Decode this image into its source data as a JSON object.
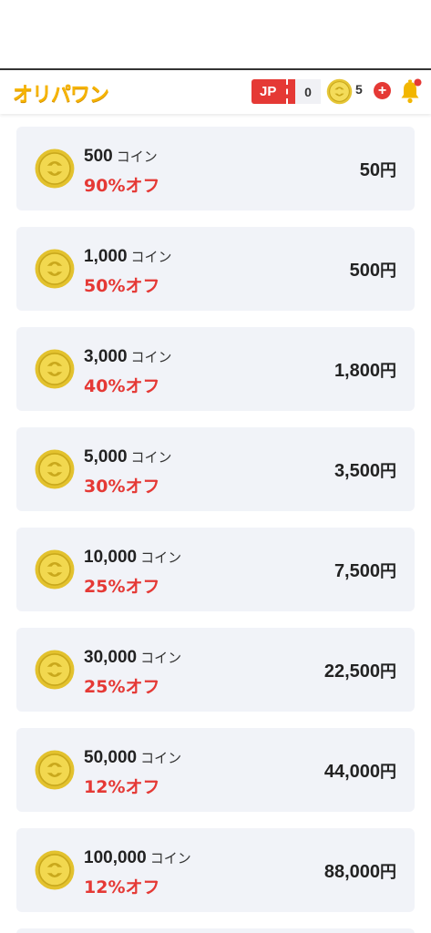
{
  "header": {
    "logo": "オリパワン",
    "jp_label": "JP",
    "jp_count": "0",
    "coin_count": "5",
    "icons": [
      "coin-icon",
      "plus-icon",
      "bell-icon"
    ],
    "accent": "#e53935",
    "brand": "#f6b400"
  },
  "packages": [
    {
      "coins": "500",
      "unit": "コイン",
      "discount": "90%オフ",
      "price": "50",
      "yen": "円"
    },
    {
      "coins": "1,000",
      "unit": "コイン",
      "discount": "50%オフ",
      "price": "500",
      "yen": "円"
    },
    {
      "coins": "3,000",
      "unit": "コイン",
      "discount": "40%オフ",
      "price": "1,800",
      "yen": "円"
    },
    {
      "coins": "5,000",
      "unit": "コイン",
      "discount": "30%オフ",
      "price": "3,500",
      "yen": "円"
    },
    {
      "coins": "10,000",
      "unit": "コイン",
      "discount": "25%オフ",
      "price": "7,500",
      "yen": "円"
    },
    {
      "coins": "30,000",
      "unit": "コイン",
      "discount": "25%オフ",
      "price": "22,500",
      "yen": "円"
    },
    {
      "coins": "50,000",
      "unit": "コイン",
      "discount": "12%オフ",
      "price": "44,000",
      "yen": "円"
    },
    {
      "coins": "100,000",
      "unit": "コイン",
      "discount": "12%オフ",
      "price": "88,000",
      "yen": "円"
    }
  ]
}
